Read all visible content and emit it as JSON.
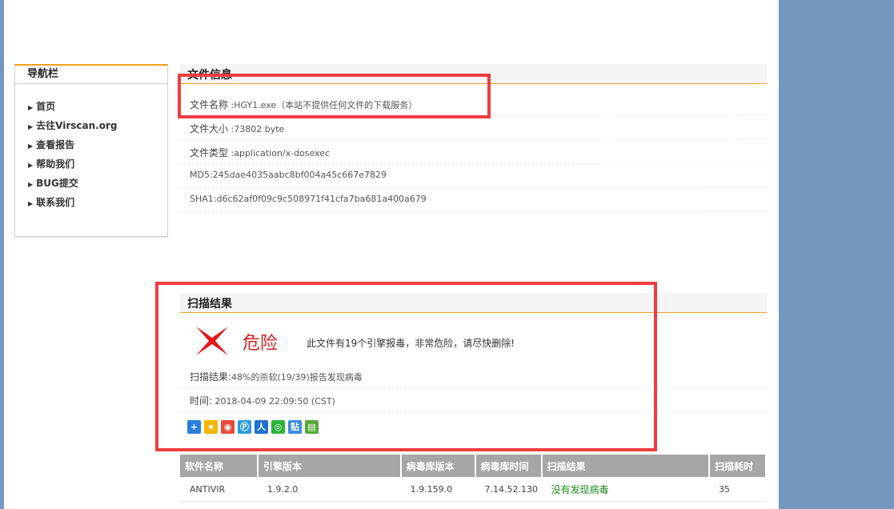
{
  "nav": {
    "title": "导航栏",
    "items": [
      "首页",
      "去往Virscan.org",
      "查看报告",
      "帮助我们",
      "BUG提交",
      "联系我们"
    ]
  },
  "file_info": {
    "title": "文件信息",
    "name_label": "文件名称",
    "name_value": ":HGY1.exe（本站不提供任何文件的下载服务）",
    "size_label": "文件大小",
    "size_value": ":73802 byte",
    "type_label": "文件类型",
    "type_value": ":application/x-dosexec",
    "md5": "MD5:245dae4035aabc8bf004a45c667e7829",
    "sha1": "SHA1:d6c62af0f09c9c508971f41cfa7ba681a400a679"
  },
  "scan": {
    "title": "扫描结果",
    "verdict": "危险",
    "message": "此文件有19个引擎报毒，非常危险，请尽快删除!",
    "result_label": "扫描结果:",
    "result_value": "48%的杀软(19/39)报告发现病毒",
    "time_label": "时间:",
    "time_value": "2018-04-09 22:09:50 (CST)"
  },
  "table": {
    "headers": [
      "软件名称",
      "引擎版本",
      "病毒库版本",
      "病毒库时间",
      "扫描结果",
      "扫描耗时"
    ],
    "rows": [
      [
        "ANTIVIR",
        "1.9.2.0",
        "1.9.159.0",
        "7.14.52.130",
        "没有发现病毒",
        "35"
      ]
    ]
  },
  "colors": {
    "accent": "#f0a020",
    "danger": "#d42020",
    "highlight_box": "#f03c40",
    "ok": "#1a8a1a"
  }
}
